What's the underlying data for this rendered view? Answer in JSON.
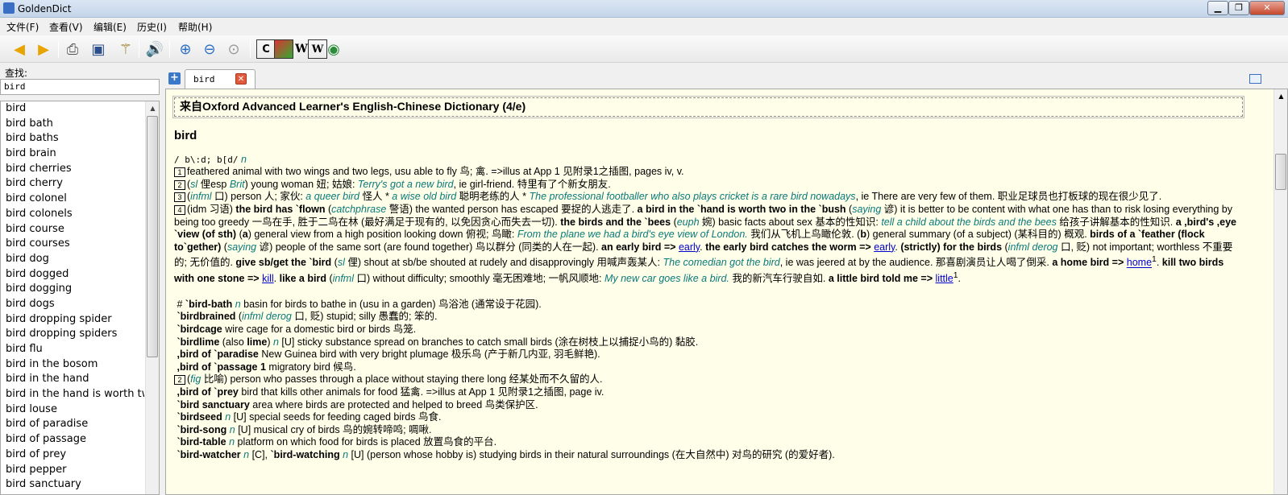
{
  "window": {
    "title": "GoldenDict"
  },
  "menu": [
    "文件(F)",
    "查看(V)",
    "编辑(E)",
    "历史(I)",
    "帮助(H)"
  ],
  "left": {
    "lookup_label": "查找:",
    "search_value": "bird",
    "words": [
      "bird",
      "bird bath",
      "bird baths",
      "bird brain",
      "bird cherries",
      "bird cherry",
      "bird colonel",
      "bird colonels",
      "bird course",
      "bird courses",
      "bird dog",
      "bird dogged",
      "bird dogging",
      "bird dogs",
      "bird dropping spider",
      "bird dropping spiders",
      "bird flu",
      "bird in the bosom",
      "bird in the hand",
      "bird in the hand is worth two in",
      "bird louse",
      "bird of paradise",
      "bird of passage",
      "bird of prey",
      "bird pepper",
      "bird sanctuary"
    ]
  },
  "tab": {
    "label": "bird"
  },
  "article": {
    "dict_title": "来自Oxford Advanced Learner's English-Chinese Dictionary (4/e)",
    "headword": "bird",
    "phonetic": "/ b\\:d; b[d/",
    "pos": "n"
  }
}
